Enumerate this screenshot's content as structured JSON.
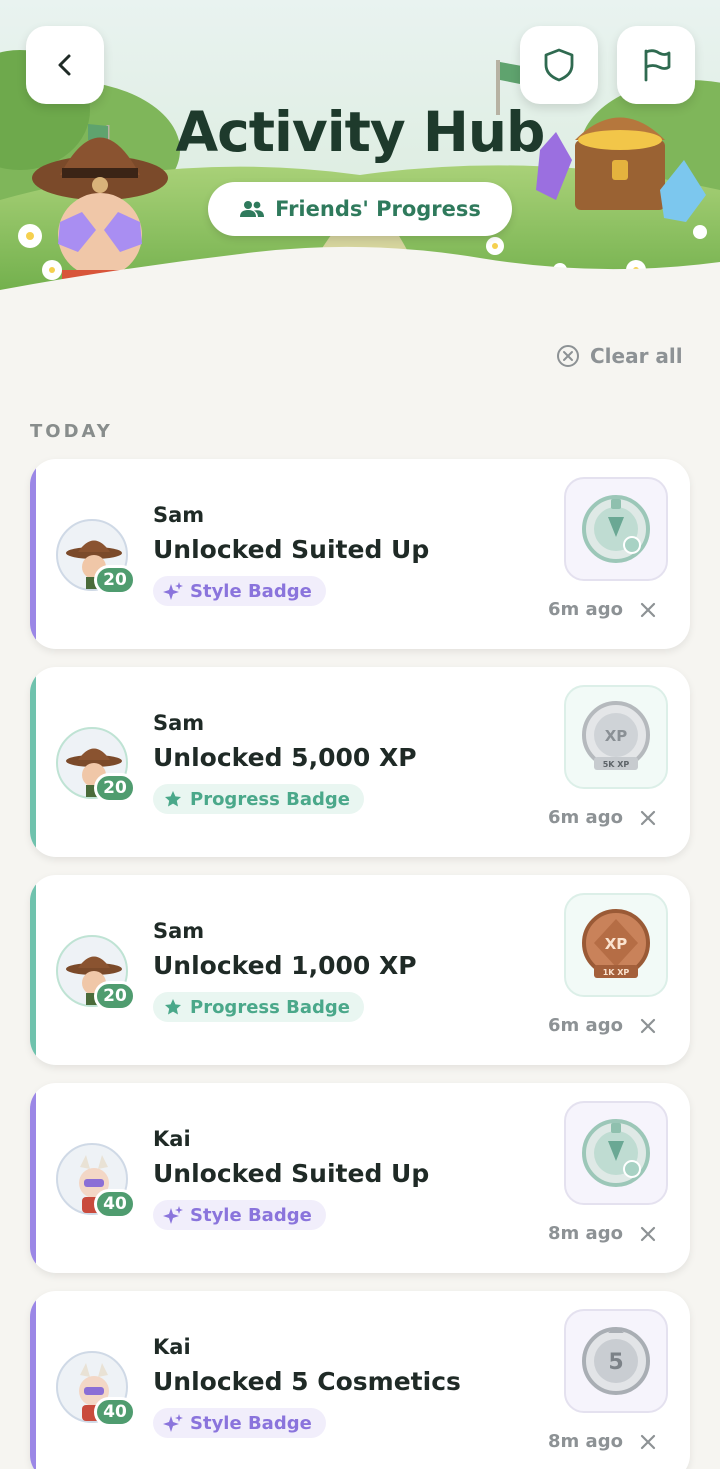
{
  "header": {
    "title": "Activity Hub",
    "friends_label": "Friends' Progress"
  },
  "toolbar": {
    "back_icon": "chevron-left-icon",
    "shield_icon": "shield-icon",
    "flag_icon": "flag-icon"
  },
  "clear_all": "Clear all",
  "section": "TODAY",
  "colors": {
    "style_accent": "#9b87e6",
    "progress_accent": "#6fc2ad",
    "level_green": "#4f9c6f",
    "title_dark_green": "#1e3a2c"
  },
  "activities": [
    {
      "user": "Sam",
      "level": "20",
      "title": "Unlocked Suited Up",
      "tag": "Style Badge",
      "tag_type": "style",
      "time": "6m ago",
      "badge": "suited-up-badge"
    },
    {
      "user": "Sam",
      "level": "20",
      "title": "Unlocked 5,000 XP",
      "tag": "Progress Badge",
      "tag_type": "progress",
      "time": "6m ago",
      "badge": "5k-xp-badge",
      "badge_text": "XP",
      "badge_sub": "5K XP"
    },
    {
      "user": "Sam",
      "level": "20",
      "title": "Unlocked 1,000 XP",
      "tag": "Progress Badge",
      "tag_type": "progress",
      "time": "6m ago",
      "badge": "1k-xp-badge",
      "badge_text": "XP",
      "badge_sub": "1K XP"
    },
    {
      "user": "Kai",
      "level": "40",
      "title": "Unlocked Suited Up",
      "tag": "Style Badge",
      "tag_type": "style",
      "time": "8m ago",
      "badge": "suited-up-badge"
    },
    {
      "user": "Kai",
      "level": "40",
      "title": "Unlocked 5 Cosmetics",
      "tag": "Style Badge",
      "tag_type": "style",
      "time": "8m ago",
      "badge": "5-cosmetics-badge",
      "badge_text": "5"
    }
  ]
}
